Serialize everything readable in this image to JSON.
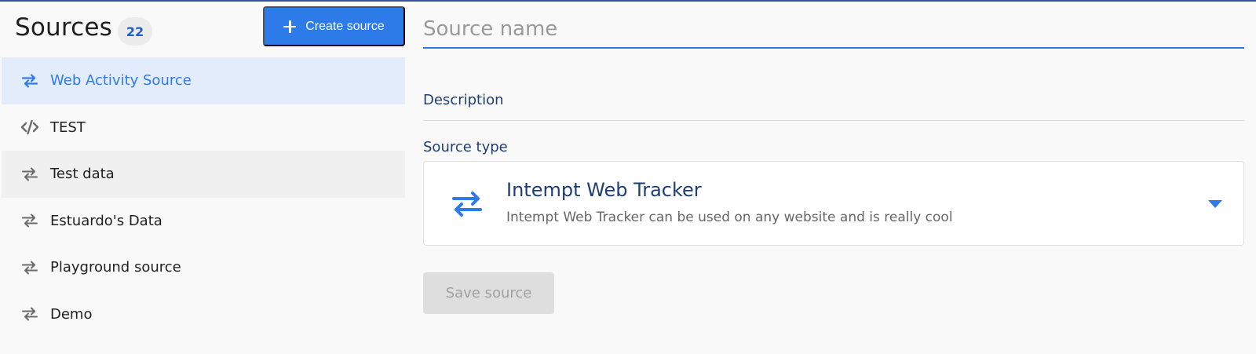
{
  "sidebar": {
    "title": "Sources",
    "count": "22",
    "create_label": "Create source",
    "items": [
      {
        "label": "Web Activity Source",
        "icon": "transfer-icon"
      },
      {
        "label": "TEST",
        "icon": "code-icon"
      },
      {
        "label": "Test data",
        "icon": "transfer-icon"
      },
      {
        "label": "Estuardo's Data",
        "icon": "transfer-icon"
      },
      {
        "label": "Playground source",
        "icon": "transfer-icon"
      },
      {
        "label": "Demo",
        "icon": "transfer-icon"
      }
    ]
  },
  "form": {
    "name_value": "",
    "name_placeholder": "Source name",
    "description_label": "Description",
    "type_label": "Source type",
    "selected_type": {
      "name": "Intempt Web Tracker",
      "description": "Intempt Web Tracker can be used on any website and is really cool",
      "icon": "transfer-icon"
    },
    "save_label": "Save source"
  },
  "colors": {
    "accent": "#2d7be8",
    "selected_bg": "#e3ecfb",
    "label_navy": "#1f3f73",
    "count_text": "#1f5fc9"
  }
}
